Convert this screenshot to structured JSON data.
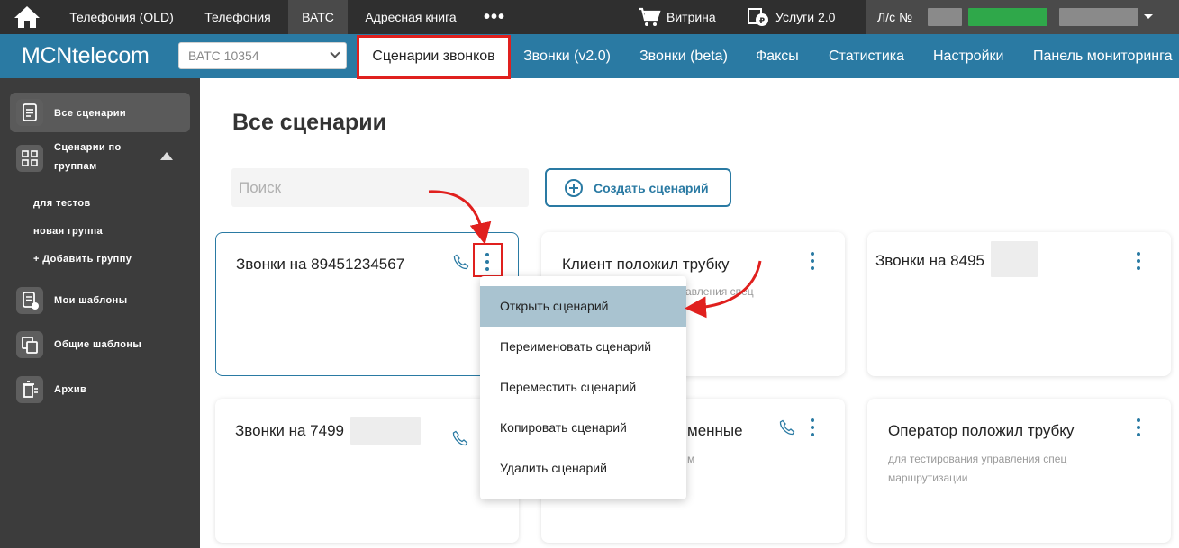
{
  "topbar": {
    "items": [
      {
        "label": "Телефония (OLD)"
      },
      {
        "label": "Телефония"
      },
      {
        "label": "ВАТС"
      },
      {
        "label": "Адресная книга"
      }
    ],
    "more_label": "•••",
    "vitrina_label": "Витрина",
    "services_label": "Услуги 2.0",
    "account_label": "Л/с №"
  },
  "bluebar": {
    "logo": "MCNtelecom",
    "vats_select_value": "ВАТС 10354",
    "nav": [
      {
        "label": "Сценарии звонков"
      },
      {
        "label": "Звонки (v2.0)"
      },
      {
        "label": "Звонки (beta)"
      },
      {
        "label": "Факсы"
      },
      {
        "label": "Статистика"
      },
      {
        "label": "Настройки"
      },
      {
        "label": "Панель мониторинга"
      }
    ]
  },
  "sidebar": {
    "all_scenarios": "Все сценарии",
    "groups_line1": "Сценарии по",
    "groups_line2": "группам",
    "groups": [
      "для тестов",
      "новая группа"
    ],
    "add_group": "+ Добавить группу",
    "my_templates": "Мои шаблоны",
    "common_templates": "Общие шаблоны",
    "archive": "Архив"
  },
  "main": {
    "title": "Все сценарии",
    "search_placeholder": "Поиск",
    "create_label": "Создать сценарий",
    "cards": [
      {
        "title": "Звонки на 89451234567",
        "desc1": "",
        "desc2": ""
      },
      {
        "title": "Клиент положил трубку",
        "desc1": "авления спец",
        "desc2": ""
      },
      {
        "title": "Звонки на 8495",
        "desc1": "",
        "desc2": ""
      },
      {
        "title": "Звонки на 7499",
        "desc1": "",
        "desc2": ""
      },
      {
        "title": "менные",
        "desc1": "м",
        "desc2": ""
      },
      {
        "title": "Оператор положил трубку",
        "desc1": "для тестирования управления спец",
        "desc2": "маршрутизации"
      }
    ]
  },
  "context_menu": {
    "items": [
      {
        "label": "Открыть сценарий"
      },
      {
        "label": "Переименовать сценарий"
      },
      {
        "label": "Переместить сценарий"
      },
      {
        "label": "Копировать сценарий"
      },
      {
        "label": "Удалить сценарий"
      }
    ]
  },
  "colors": {
    "topbar": "#2f2f2f",
    "brand_blue": "#2a7aa3",
    "sidebar": "#3c3c3c",
    "highlight_red": "#e0201e",
    "menu_hover": "#a9c3d0",
    "account_green": "#2fa84a"
  }
}
